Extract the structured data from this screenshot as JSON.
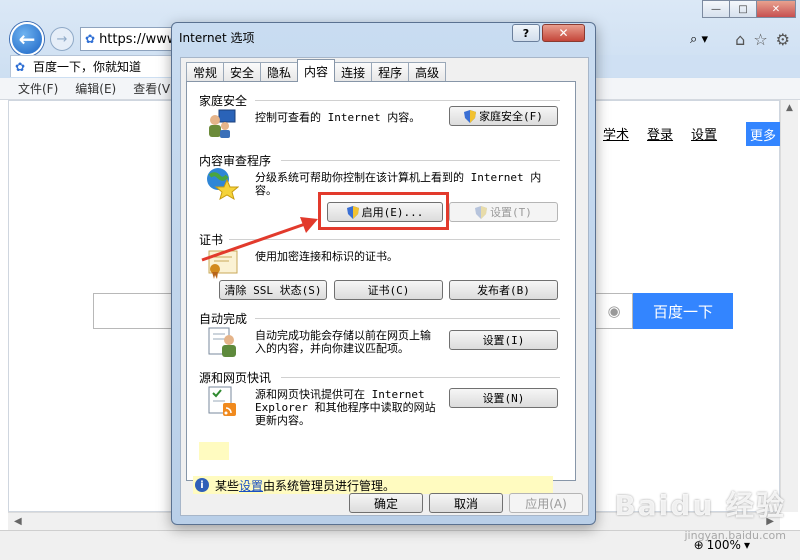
{
  "browser": {
    "address_text": "https://www",
    "tab_title": "百度一下，你就知道",
    "menu": [
      "文件(F)",
      "编辑(E)",
      "查看(V)"
    ],
    "search_glyph": "⌕ ▾",
    "zoom": "100%"
  },
  "page": {
    "nav_links": [
      "学术",
      "登录",
      "设置"
    ],
    "more_label": "更多",
    "search_button": "百度一下",
    "watermark": "Baidu 经验",
    "watermark_sub": "jingyan.baidu.com"
  },
  "dialog": {
    "title": "Internet 选项",
    "help": "?",
    "close": "✕",
    "tabs": [
      "常规",
      "安全",
      "隐私",
      "内容",
      "连接",
      "程序",
      "高级"
    ],
    "active_tab_index": 3,
    "sections": {
      "family_safety": {
        "title": "家庭安全",
        "desc": "控制可查看的 Internet 内容。",
        "button": "家庭安全(F)"
      },
      "content_advisor": {
        "title": "内容审查程序",
        "desc": "分级系统可帮助你控制在该计算机上看到的 Internet 内容。",
        "enable_button": "启用(E)...",
        "settings_button": "设置(T)"
      },
      "certificates": {
        "title": "证书",
        "desc": "使用加密连接和标识的证书。",
        "clear_ssl": "清除 SSL 状态(S)",
        "certs": "证书(C)",
        "publishers": "发布者(B)"
      },
      "autocomplete": {
        "title": "自动完成",
        "desc": "自动完成功能会存储以前在网页上输入的内容，并向你建议匹配项。",
        "button": "设置(I)"
      },
      "feeds": {
        "title": "源和网页快讯",
        "desc": "源和网页快讯提供可在 Internet Explorer 和其他程序中读取的网站更新内容。",
        "button": "设置(N)"
      }
    },
    "info": {
      "prefix": "某些",
      "link": "设置",
      "suffix": "由系统管理员进行管理。"
    },
    "footer": {
      "ok": "确定",
      "cancel": "取消",
      "apply": "应用(A)"
    }
  },
  "colors": {
    "annotation": "#e23a2c",
    "baidu_blue": "#3385ff"
  }
}
